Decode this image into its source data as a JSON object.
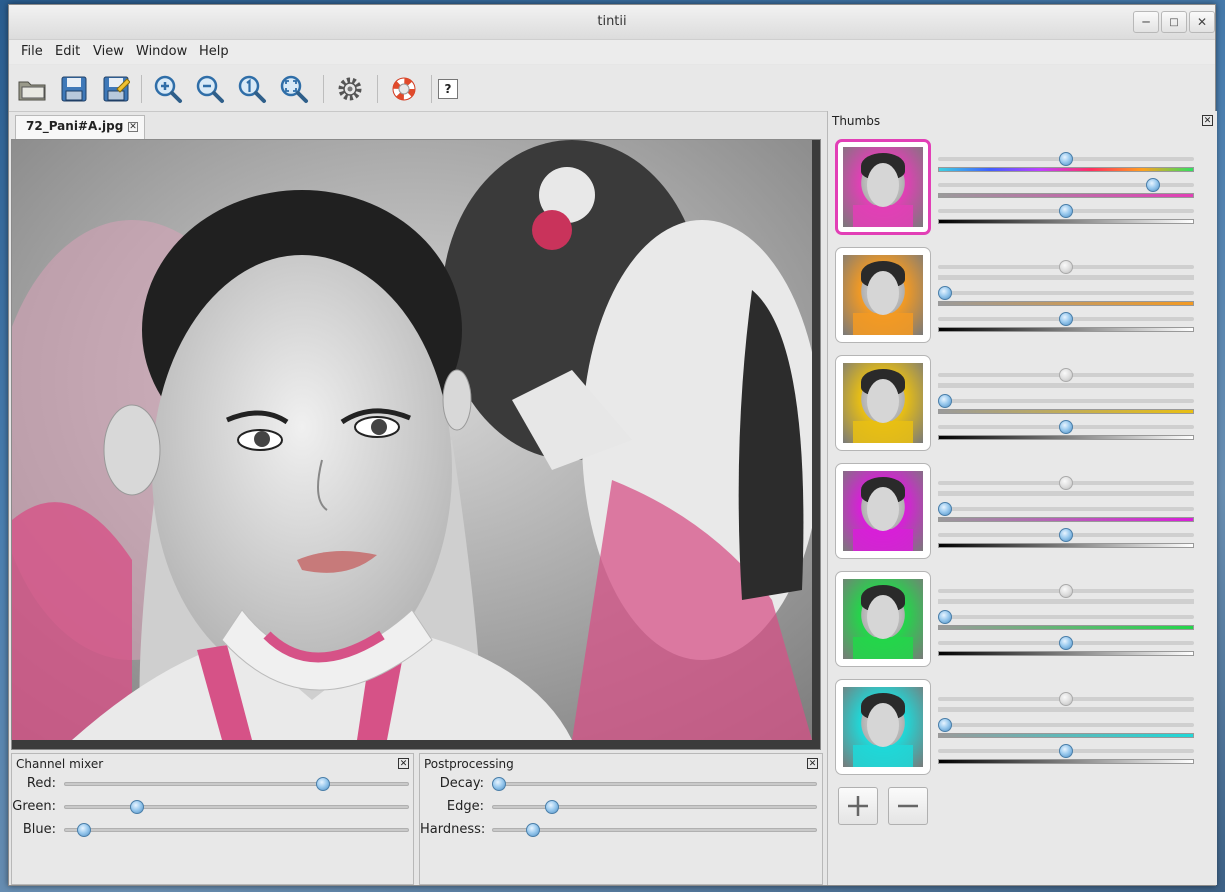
{
  "window": {
    "title": "tintii"
  },
  "menu": [
    "File",
    "Edit",
    "View",
    "Window",
    "Help"
  ],
  "toolbar": {
    "icons": [
      "open-folder-icon",
      "save-icon",
      "save-as-icon",
      "zoom-in-icon",
      "zoom-out-icon",
      "zoom-actual-icon",
      "zoom-fit-icon",
      "settings-gear-icon",
      "help-lifebuoy-icon",
      "whats-this-icon"
    ],
    "help_label": "?"
  },
  "document": {
    "tab_label": "72_Pani#A.jpg"
  },
  "channel_mixer": {
    "title": "Channel mixer",
    "sliders": [
      {
        "label": "Red:",
        "value": 0.76
      },
      {
        "label": "Green:",
        "value": 0.2
      },
      {
        "label": "Blue:",
        "value": 0.04
      }
    ]
  },
  "postprocessing": {
    "title": "Postprocessing",
    "sliders": [
      {
        "label": "Decay:",
        "value": 0.0
      },
      {
        "label": "Edge:",
        "value": 0.17
      },
      {
        "label": "Hardness:",
        "value": 0.11
      }
    ]
  },
  "thumbs": {
    "title": "Thumbs",
    "items": [
      {
        "color": "#e23fb6",
        "hue": 0.5,
        "sat": 0.86,
        "light": 0.5,
        "selected": true
      },
      {
        "color": "#f39a23",
        "hue": 0.5,
        "sat": 0.0,
        "light": 0.5,
        "selected": false
      },
      {
        "color": "#e9bf13",
        "hue": 0.5,
        "sat": 0.0,
        "light": 0.5,
        "selected": false
      },
      {
        "color": "#d81fd8",
        "hue": 0.5,
        "sat": 0.0,
        "light": 0.5,
        "selected": false
      },
      {
        "color": "#23d64a",
        "hue": 0.5,
        "sat": 0.0,
        "light": 0.5,
        "selected": false
      },
      {
        "color": "#1fd8d8",
        "hue": 0.5,
        "sat": 0.0,
        "light": 0.5,
        "selected": false
      }
    ],
    "add_icon": "plus-icon",
    "remove_icon": "minus-icon"
  }
}
